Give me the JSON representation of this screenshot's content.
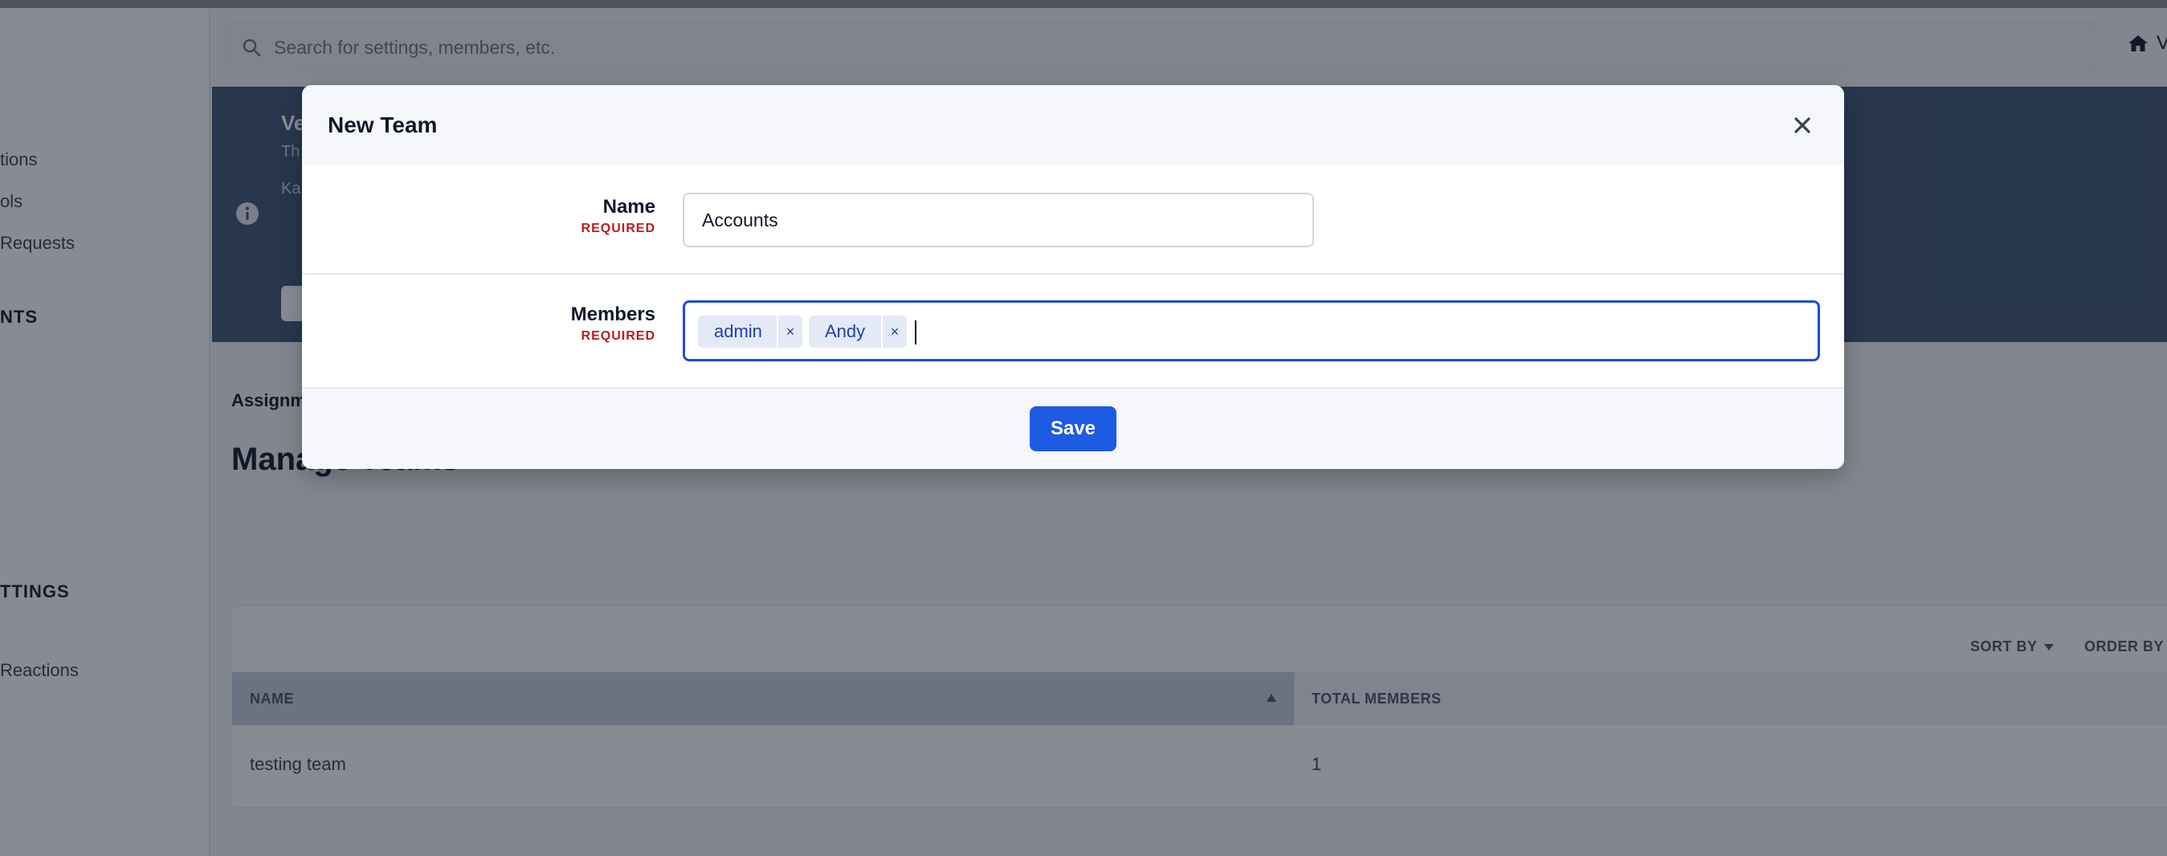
{
  "sidebar": {
    "items": [
      {
        "label": "tions"
      },
      {
        "label": "ols"
      },
      {
        "label": " Requests"
      }
    ],
    "section_1": "NTS",
    "section_2": "TTINGS",
    "items_2": [
      {
        "label": "Reactions"
      }
    ]
  },
  "search": {
    "placeholder": "Search for settings, members, etc."
  },
  "home_link": {
    "label": "V"
  },
  "banner": {
    "title": "Ve",
    "subtitle": "Th",
    "line": "Ka"
  },
  "breadcrumb": {
    "label": "Assignm"
  },
  "page": {
    "title": "Manage Teams"
  },
  "table": {
    "sort_by_label": "SORT BY",
    "order_by_label": "ORDER BY",
    "columns": [
      "NAME",
      "TOTAL MEMBERS"
    ],
    "rows": [
      {
        "name": "testing team",
        "total_members": "1"
      }
    ]
  },
  "modal": {
    "title": "New Team",
    "name_label": "Name",
    "name_required": "REQUIRED",
    "name_value": "Accounts",
    "members_label": "Members",
    "members_required": "REQUIRED",
    "members": [
      {
        "label": "admin"
      },
      {
        "label": "Andy"
      }
    ],
    "chip_remove_glyph": "×",
    "save_label": "Save"
  },
  "colors": {
    "accent": "#1d5be3",
    "required": "#b91c1c",
    "banner": "#3e5774",
    "chip_bg": "#e3e9f5"
  }
}
